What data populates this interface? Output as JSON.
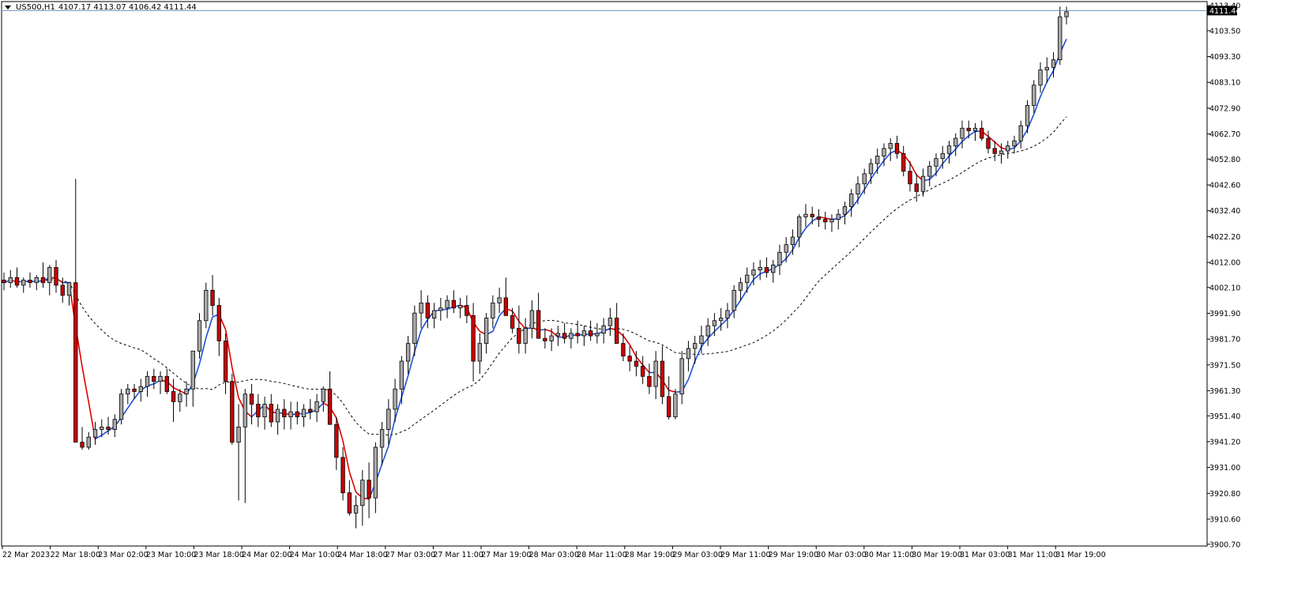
{
  "header": {
    "symbol": "US500,H1",
    "ohlc": "4107.17 4113.07 4106.42 4111.44"
  },
  "price_tag": "4111.44",
  "colors": {
    "bull_body": "#a9a9a9",
    "bear_body": "#cc0000",
    "wick": "#000000",
    "ma_up": "#1f4fd6",
    "ma_down": "#e00000",
    "ma_slow": "#000000",
    "bid_line": "#6f93b8",
    "price_tag_bg": "#000000"
  },
  "chart_data": {
    "type": "candlestick",
    "symbol": "US500",
    "timeframe": "H1",
    "ylim": [
      3900.0,
      4115.0
    ],
    "y_ticks": [
      "4113.40",
      "4103.50",
      "4093.30",
      "4083.10",
      "4072.90",
      "4062.70",
      "4052.80",
      "4042.60",
      "4032.40",
      "4022.20",
      "4012.00",
      "4002.10",
      "3991.90",
      "3981.70",
      "3971.50",
      "3961.30",
      "3951.40",
      "3941.20",
      "3931.00",
      "3920.80",
      "3910.60",
      "3900.70"
    ],
    "x_ticks": [
      "22 Mar 2023",
      "22 Mar 18:00",
      "23 Mar 02:00",
      "23 Mar 10:00",
      "23 Mar 18:00",
      "24 Mar 02:00",
      "24 Mar 10:00",
      "24 Mar 18:00",
      "27 Mar 03:00",
      "27 Mar 11:00",
      "27 Mar 19:00",
      "28 Mar 03:00",
      "28 Mar 11:00",
      "28 Mar 19:00",
      "29 Mar 03:00",
      "29 Mar 11:00",
      "29 Mar 19:00",
      "30 Mar 03:00",
      "30 Mar 11:00",
      "30 Mar 19:00",
      "31 Mar 03:00",
      "31 Mar 11:00",
      "31 Mar 19:00"
    ],
    "last_price": 4111.44,
    "candles": [
      [
        4005,
        4008,
        4001,
        4004
      ],
      [
        4004,
        4009,
        4002,
        4006
      ],
      [
        4006,
        4010,
        4002,
        4003
      ],
      [
        4003,
        4006,
        4000,
        4005
      ],
      [
        4005,
        4008,
        4002,
        4004
      ],
      [
        4004,
        4007,
        4001,
        4006
      ],
      [
        4006,
        4012,
        4002,
        4004
      ],
      [
        4004,
        4011,
        3999,
        4010
      ],
      [
        4010,
        4013,
        4000,
        4003
      ],
      [
        4003,
        4006,
        3996,
        3999
      ],
      [
        3999,
        4004,
        3995,
        4004
      ],
      [
        4004,
        4045,
        3941,
        3941
      ],
      [
        3941,
        3947,
        3938,
        3939
      ],
      [
        3939,
        3945,
        3938,
        3943
      ],
      [
        3943,
        3949,
        3940,
        3946
      ],
      [
        3946,
        3950,
        3943,
        3947
      ],
      [
        3947,
        3951,
        3944,
        3946
      ],
      [
        3946,
        3952,
        3943,
        3950
      ],
      [
        3950,
        3962,
        3948,
        3960
      ],
      [
        3960,
        3964,
        3956,
        3962
      ],
      [
        3962,
        3964,
        3958,
        3961
      ],
      [
        3961,
        3966,
        3957,
        3963
      ],
      [
        3963,
        3969,
        3959,
        3967
      ],
      [
        3967,
        3970,
        3962,
        3965
      ],
      [
        3965,
        3969,
        3960,
        3967
      ],
      [
        3967,
        3970,
        3960,
        3961
      ],
      [
        3961,
        3966,
        3949,
        3957
      ],
      [
        3957,
        3962,
        3953,
        3960
      ],
      [
        3960,
        3965,
        3955,
        3962
      ],
      [
        3962,
        3970,
        3955,
        3977
      ],
      [
        3977,
        3992,
        3974,
        3989
      ],
      [
        3989,
        4004,
        3986,
        4001
      ],
      [
        4001,
        4007,
        3991,
        3995
      ],
      [
        3995,
        3998,
        3975,
        3981
      ],
      [
        3981,
        3984,
        3960,
        3965
      ],
      [
        3965,
        3968,
        3940,
        3941
      ],
      [
        3941,
        3956,
        3918,
        3947
      ],
      [
        3947,
        3962,
        3917,
        3960
      ],
      [
        3960,
        3964,
        3948,
        3956
      ],
      [
        3956,
        3960,
        3947,
        3951
      ],
      [
        3951,
        3959,
        3946,
        3956
      ],
      [
        3956,
        3960,
        3947,
        3949
      ],
      [
        3949,
        3956,
        3944,
        3954
      ],
      [
        3954,
        3958,
        3946,
        3951
      ],
      [
        3951,
        3957,
        3946,
        3953
      ],
      [
        3953,
        3957,
        3948,
        3951
      ],
      [
        3951,
        3956,
        3947,
        3954
      ],
      [
        3954,
        3958,
        3950,
        3953
      ],
      [
        3953,
        3960,
        3949,
        3957
      ],
      [
        3957,
        3963,
        3953,
        3962
      ],
      [
        3962,
        3969,
        3956,
        3948
      ],
      [
        3948,
        3951,
        3930,
        3935
      ],
      [
        3935,
        3939,
        3918,
        3921
      ],
      [
        3921,
        3926,
        3912,
        3913
      ],
      [
        3913,
        3920,
        3907,
        3916
      ],
      [
        3916,
        3930,
        3908,
        3926
      ],
      [
        3926,
        3933,
        3911,
        3919
      ],
      [
        3919,
        3941,
        3913,
        3939
      ],
      [
        3939,
        3949,
        3932,
        3946
      ],
      [
        3946,
        3958,
        3940,
        3954
      ],
      [
        3954,
        3966,
        3949,
        3962
      ],
      [
        3962,
        3975,
        3956,
        3973
      ],
      [
        3973,
        3983,
        3968,
        3980
      ],
      [
        3980,
        3995,
        3975,
        3992
      ],
      [
        3992,
        4001,
        3986,
        3996
      ],
      [
        3996,
        3999,
        3986,
        3990
      ],
      [
        3990,
        3996,
        3986,
        3993
      ],
      [
        3993,
        3998,
        3989,
        3994
      ],
      [
        3994,
        3999,
        3990,
        3997
      ],
      [
        3997,
        4001,
        3992,
        3994
      ],
      [
        3994,
        3998,
        3990,
        3995
      ],
      [
        3995,
        3999,
        3988,
        3991
      ],
      [
        3991,
        3996,
        3965,
        3973
      ],
      [
        3973,
        3984,
        3968,
        3980
      ],
      [
        3980,
        3992,
        3976,
        3990
      ],
      [
        3990,
        3999,
        3986,
        3996
      ],
      [
        3996,
        4002,
        3992,
        3998
      ],
      [
        3998,
        4006,
        3994,
        3991
      ],
      [
        3991,
        3994,
        3984,
        3986
      ],
      [
        3986,
        3995,
        3976,
        3980
      ],
      [
        3980,
        3990,
        3976,
        3986
      ],
      [
        3986,
        3997,
        3982,
        3993
      ],
      [
        3993,
        4000,
        3986,
        3982
      ],
      [
        3982,
        3986,
        3978,
        3981
      ],
      [
        3981,
        3986,
        3977,
        3983
      ],
      [
        3983,
        3987,
        3979,
        3984
      ],
      [
        3984,
        3988,
        3980,
        3982
      ],
      [
        3982,
        3986,
        3978,
        3984
      ],
      [
        3984,
        3989,
        3980,
        3983
      ],
      [
        3983,
        3987,
        3979,
        3985
      ],
      [
        3985,
        3989,
        3981,
        3983
      ],
      [
        3983,
        3988,
        3980,
        3984
      ],
      [
        3984,
        3990,
        3980,
        3987
      ],
      [
        3987,
        3994,
        3983,
        3990
      ],
      [
        3990,
        3996,
        3985,
        3980
      ],
      [
        3980,
        3984,
        3973,
        3975
      ],
      [
        3975,
        3979,
        3969,
        3973
      ],
      [
        3973,
        3977,
        3967,
        3971
      ],
      [
        3971,
        3975,
        3964,
        3967
      ],
      [
        3967,
        3972,
        3960,
        3963
      ],
      [
        3963,
        3977,
        3958,
        3973
      ],
      [
        3973,
        3979,
        3956,
        3959
      ],
      [
        3959,
        3967,
        3950,
        3951
      ],
      [
        3951,
        3962,
        3950,
        3960
      ],
      [
        3960,
        3977,
        3956,
        3974
      ],
      [
        3974,
        3981,
        3969,
        3978
      ],
      [
        3978,
        3983,
        3972,
        3980
      ],
      [
        3980,
        3987,
        3976,
        3983
      ],
      [
        3983,
        3990,
        3979,
        3987
      ],
      [
        3987,
        3992,
        3983,
        3989
      ],
      [
        3989,
        3994,
        3985,
        3990
      ],
      [
        3990,
        3996,
        3986,
        3993
      ],
      [
        3993,
        4003,
        3990,
        4001
      ],
      [
        4001,
        4006,
        3997,
        4004
      ],
      [
        4004,
        4010,
        4000,
        4007
      ],
      [
        4007,
        4012,
        4003,
        4009
      ],
      [
        4009,
        4013,
        4005,
        4010
      ],
      [
        4010,
        4014,
        4006,
        4008
      ],
      [
        4008,
        4013,
        4004,
        4011
      ],
      [
        4011,
        4019,
        4007,
        4016
      ],
      [
        4016,
        4022,
        4012,
        4019
      ],
      [
        4019,
        4025,
        4015,
        4022
      ],
      [
        4022,
        4031,
        4018,
        4030
      ],
      [
        4030,
        4035,
        4026,
        4031
      ],
      [
        4031,
        4034,
        4027,
        4030
      ],
      [
        4030,
        4033,
        4026,
        4029
      ],
      [
        4029,
        4032,
        4025,
        4028
      ],
      [
        4028,
        4031,
        4024,
        4029
      ],
      [
        4029,
        4033,
        4025,
        4031
      ],
      [
        4031,
        4036,
        4027,
        4034
      ],
      [
        4034,
        4041,
        4030,
        4039
      ],
      [
        4039,
        4046,
        4035,
        4043
      ],
      [
        4043,
        4049,
        4039,
        4047
      ],
      [
        4047,
        4053,
        4043,
        4051
      ],
      [
        4051,
        4057,
        4047,
        4054
      ],
      [
        4054,
        4059,
        4050,
        4057
      ],
      [
        4057,
        4061,
        4052,
        4059
      ],
      [
        4059,
        4062,
        4053,
        4055
      ],
      [
        4055,
        4058,
        4046,
        4048
      ],
      [
        4048,
        4052,
        4040,
        4043
      ],
      [
        4043,
        4047,
        4036,
        4040
      ],
      [
        4040,
        4049,
        4038,
        4046
      ],
      [
        4046,
        4052,
        4042,
        4050
      ],
      [
        4050,
        4055,
        4046,
        4053
      ],
      [
        4053,
        4058,
        4049,
        4055
      ],
      [
        4055,
        4060,
        4051,
        4058
      ],
      [
        4058,
        4063,
        4054,
        4061
      ],
      [
        4061,
        4068,
        4057,
        4065
      ],
      [
        4065,
        4068,
        4061,
        4064
      ],
      [
        4064,
        4067,
        4060,
        4065
      ],
      [
        4065,
        4068,
        4060,
        4061
      ],
      [
        4061,
        4064,
        4055,
        4057
      ],
      [
        4057,
        4060,
        4052,
        4055
      ],
      [
        4055,
        4059,
        4051,
        4056
      ],
      [
        4056,
        4060,
        4053,
        4058
      ],
      [
        4058,
        4062,
        4055,
        4060
      ],
      [
        4060,
        4068,
        4057,
        4066
      ],
      [
        4066,
        4076,
        4063,
        4074
      ],
      [
        4074,
        4084,
        4071,
        4082
      ],
      [
        4082,
        4091,
        4079,
        4088
      ],
      [
        4088,
        4093,
        4083,
        4089
      ],
      [
        4089,
        4095,
        4085,
        4092
      ],
      [
        4092,
        4113,
        4090,
        4109
      ],
      [
        4109,
        4113,
        4106,
        4111
      ]
    ]
  }
}
